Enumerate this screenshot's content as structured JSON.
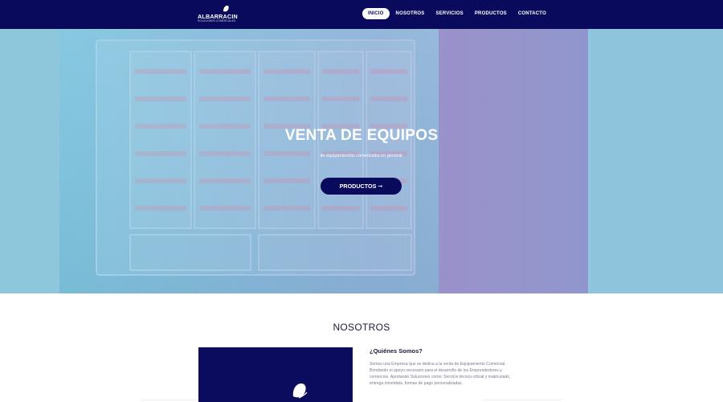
{
  "brand": {
    "name": "ALBARRACIN",
    "tagline": "SOLUCIONES COMERCIALES"
  },
  "nav": {
    "items": [
      {
        "label": "INICIO"
      },
      {
        "label": "NOSOTROS"
      },
      {
        "label": "SERVICIOS"
      },
      {
        "label": "PRODUCTOS"
      },
      {
        "label": "CONTACTO"
      }
    ],
    "active_index": 0
  },
  "hero": {
    "title": "VENTA DE EQUIPOS",
    "subtitle": "de equipamientos comerciales en general.",
    "button_label": "PRODUCTOS ➞"
  },
  "about": {
    "section_title": "NOSOTROS",
    "heading": "¿Quiénes Somos?",
    "paragraph": "Somos una Empresa que se dedica a la venta de Equipamiento Comercial. Brindando el apoyo necesario para el desarrollo de los Emprendedores y comercios. Aportando Soluciones como: Servicio técnico oficial y matriculado, entrega inmediata, formas de pago personalizadas."
  },
  "colors": {
    "navbar": "#0a0a5c",
    "accent": "#0a0a5c",
    "hero_bg": "#8ec7dc"
  }
}
